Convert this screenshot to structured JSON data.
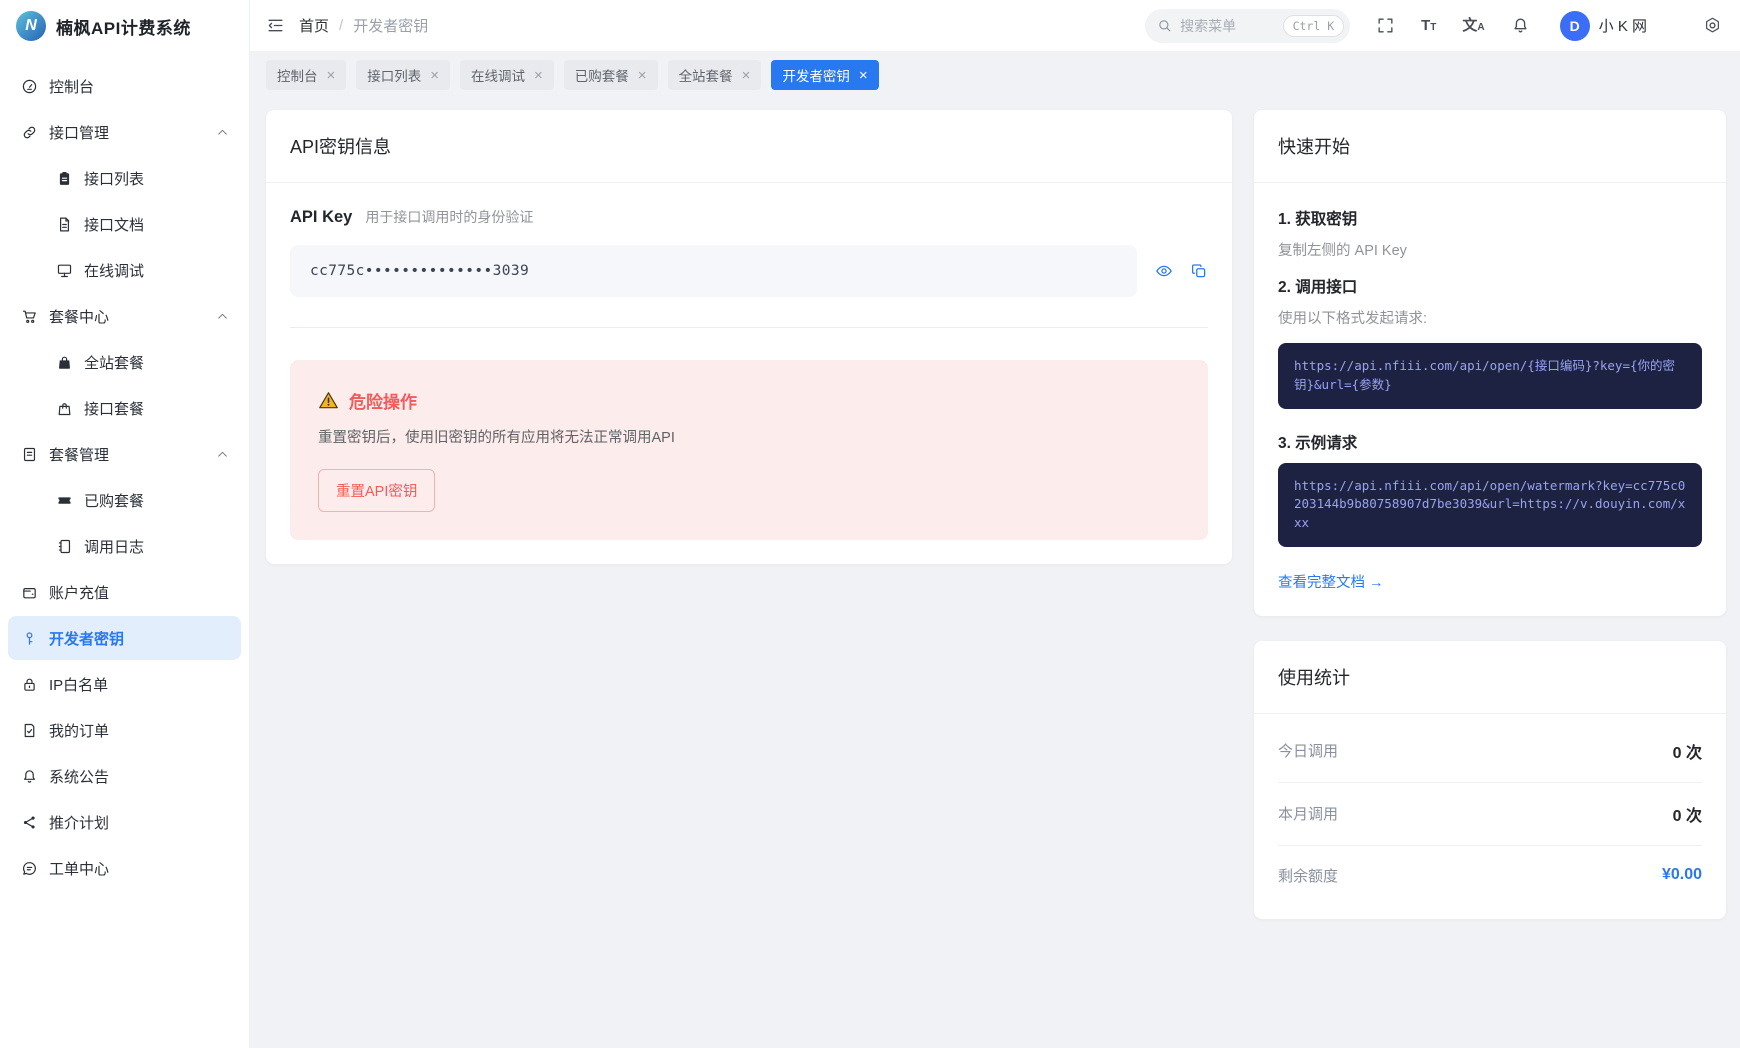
{
  "app": {
    "title": "楠枫API计费系统",
    "logo_initial": "N"
  },
  "ui": {
    "close_glyph": "×"
  },
  "colors": {
    "accent_blue": "#2878f0",
    "active_nav_bg": "#e3eefc",
    "danger_red": "#f15b5b",
    "danger_bg": "#fdecec",
    "code_bg": "#1d2142",
    "code_text": "#98a3f2",
    "warning_yellow": "#f5b51f"
  },
  "sidebar": {
    "items": [
      {
        "label": "控制台"
      },
      {
        "label": "接口管理"
      },
      {
        "label": "接口列表"
      },
      {
        "label": "接口文档"
      },
      {
        "label": "在线调试"
      },
      {
        "label": "套餐中心"
      },
      {
        "label": "全站套餐"
      },
      {
        "label": "接口套餐"
      },
      {
        "label": "套餐管理"
      },
      {
        "label": "已购套餐"
      },
      {
        "label": "调用日志"
      },
      {
        "label": "账户充值"
      },
      {
        "label": "开发者密钥"
      },
      {
        "label": "IP白名单"
      },
      {
        "label": "我的订单"
      },
      {
        "label": "系统公告"
      },
      {
        "label": "推介计划"
      },
      {
        "label": "工单中心"
      }
    ]
  },
  "header": {
    "breadcrumb": {
      "home": "首页",
      "separator": "/",
      "current": "开发者密钥"
    },
    "search": {
      "placeholder": "搜索菜单",
      "shortcut": "Ctrl K"
    },
    "font_icon": {
      "big": "T",
      "small": "T"
    },
    "lang_icon": {
      "big": "文",
      "small": "A"
    },
    "user": {
      "avatar_initial": "D",
      "name": "小 K 网"
    }
  },
  "tabs": [
    {
      "label": "控制台"
    },
    {
      "label": "接口列表"
    },
    {
      "label": "在线调试"
    },
    {
      "label": "已购套餐"
    },
    {
      "label": "全站套餐"
    },
    {
      "label": "开发者密钥"
    }
  ],
  "main": {
    "card_title": "API密钥信息",
    "api_key": {
      "label": "API Key",
      "description": "用于接口调用时的身份验证",
      "masked_value": "cc775c••••••••••••••3039"
    },
    "danger": {
      "title": "危险操作",
      "description": "重置密钥后，使用旧密钥的所有应用将无法正常调用API",
      "reset_button": "重置API密钥"
    }
  },
  "quick_start": {
    "title": "快速开始",
    "step1": {
      "title": "1. 获取密钥",
      "description": "复制左侧的 API Key"
    },
    "step2": {
      "title": "2. 调用接口",
      "description": "使用以下格式发起请求:",
      "code": "https://api.nfiii.com/api/open/{接口编码}?key={你的密钥}&url={参数}"
    },
    "step3": {
      "title": "3. 示例请求",
      "code": "https://api.nfiii.com/api/open/watermark?key=cc775c0203144b9b80758907d7be3039&url=https://v.douyin.com/xxx"
    },
    "doc_link": "查看完整文档 →"
  },
  "usage_stats": {
    "title": "使用统计",
    "rows": [
      {
        "label": "今日调用",
        "value": "0 次"
      },
      {
        "label": "本月调用",
        "value": "0 次"
      },
      {
        "label": "剩余额度",
        "value": "¥0.00"
      }
    ]
  }
}
